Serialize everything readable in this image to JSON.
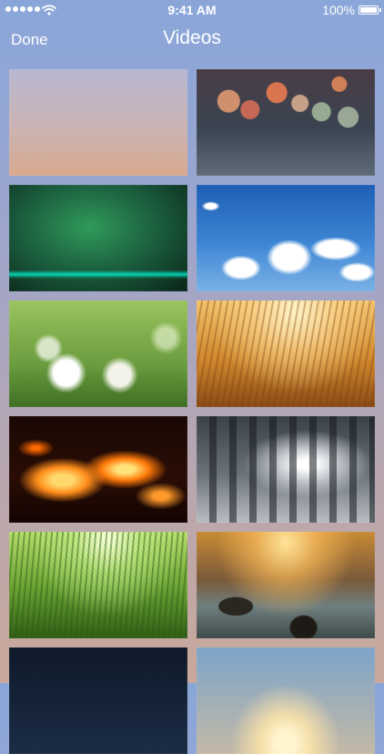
{
  "status_bar": {
    "time": "9:41 AM",
    "battery_text": "100%",
    "battery_level": 1.0,
    "signal_dots": 5
  },
  "nav_bar": {
    "done_label": "Done",
    "title": "Videos"
  },
  "videos": [
    {
      "id": 1,
      "theme": "soft gradient"
    },
    {
      "id": 2,
      "theme": "bokeh lights"
    },
    {
      "id": 3,
      "theme": "green wall glow"
    },
    {
      "id": 4,
      "theme": "blue sky clouds"
    },
    {
      "id": 5,
      "theme": "dandelions"
    },
    {
      "id": 6,
      "theme": "wheat field"
    },
    {
      "id": 7,
      "theme": "fire"
    },
    {
      "id": 8,
      "theme": "misty forest"
    },
    {
      "id": 9,
      "theme": "grass sun"
    },
    {
      "id": 10,
      "theme": "sunset lake rocks"
    },
    {
      "id": 11,
      "theme": "night sky"
    },
    {
      "id": 12,
      "theme": "sunrise glow"
    }
  ],
  "colors": {
    "background_top": "#8aa6d9",
    "background_bottom": "#c9a89b",
    "text": "#ffffff"
  }
}
